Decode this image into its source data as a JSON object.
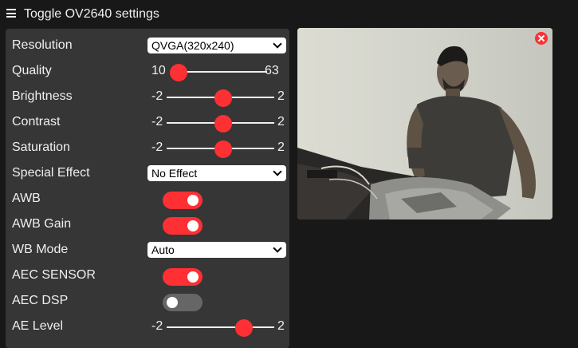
{
  "header": {
    "title": "Toggle OV2640 settings",
    "menu_icon": "hamburger-menu-icon"
  },
  "colors": {
    "accent": "#ff3034",
    "panel": "#363636",
    "background": "#181818"
  },
  "settings": {
    "resolution": {
      "label": "Resolution",
      "value": "QVGA(320x240)"
    },
    "quality": {
      "label": "Quality",
      "min": "10",
      "max": "63",
      "value": 10
    },
    "brightness": {
      "label": "Brightness",
      "min": "-2",
      "max": "2",
      "value": 0
    },
    "contrast": {
      "label": "Contrast",
      "min": "-2",
      "max": "2",
      "value": 0
    },
    "saturation": {
      "label": "Saturation",
      "min": "-2",
      "max": "2",
      "value": 0
    },
    "special_effect": {
      "label": "Special Effect",
      "value": "No Effect"
    },
    "awb": {
      "label": "AWB",
      "on": true
    },
    "awb_gain": {
      "label": "AWB Gain",
      "on": true
    },
    "wb_mode": {
      "label": "WB Mode",
      "value": "Auto"
    },
    "aec_sensor": {
      "label": "AEC SENSOR",
      "on": true
    },
    "aec_dsp": {
      "label": "AEC DSP",
      "on": false
    },
    "ae_level": {
      "label": "AE Level",
      "min": "-2",
      "max": "2",
      "value": 1
    }
  },
  "stream": {
    "close_icon": "close-icon"
  }
}
